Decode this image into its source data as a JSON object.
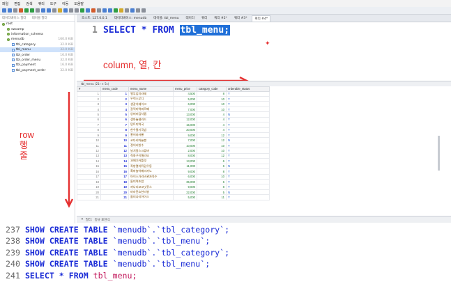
{
  "menubar": [
    "파일",
    "편집",
    "검색",
    "쿼리",
    "도구",
    "이동",
    "도움말"
  ],
  "tabs": [
    {
      "label": "호스트: 127.0.0.1",
      "active": false
    },
    {
      "label": "데이터베이스: menudb",
      "active": false
    },
    {
      "label": "테이블: tbl_menu",
      "active": false
    },
    {
      "label": "데이터",
      "active": false
    },
    {
      "label": "쿼리",
      "active": false
    },
    {
      "label": "쿼리 #2*",
      "active": false
    },
    {
      "label": "쿼리 #3*",
      "active": false
    },
    {
      "label": "쿼리 #4*",
      "active": true
    }
  ],
  "sidebar": {
    "filter_db": "데이터베이스 필터",
    "filter_table": "테이블 필터",
    "tree": [
      {
        "label": "root",
        "size": "",
        "indent": 0,
        "type": "db"
      },
      {
        "label": "swcamp",
        "size": "",
        "indent": 1,
        "type": "db"
      },
      {
        "label": "information_schema",
        "size": "",
        "indent": 1,
        "type": "db"
      },
      {
        "label": "menudb",
        "size": "160.0 KiB",
        "indent": 1,
        "type": "db"
      },
      {
        "label": "tbl_category",
        "size": "32.0 KiB",
        "indent": 2,
        "type": "table"
      },
      {
        "label": "tbl_menu",
        "size": "32.0 KiB",
        "indent": 2,
        "type": "table",
        "selected": true
      },
      {
        "label": "tbl_order",
        "size": "16.0 KiB",
        "indent": 2,
        "type": "table"
      },
      {
        "label": "tbl_order_menu",
        "size": "32.0 KiB",
        "indent": 2,
        "type": "table"
      },
      {
        "label": "tbl_payment",
        "size": "16.0 KiB",
        "indent": 2,
        "type": "table"
      },
      {
        "label": "tbl_payment_order",
        "size": "32.0 KiB",
        "indent": 2,
        "type": "table"
      }
    ]
  },
  "editor": {
    "line_number": "1",
    "sql_prefix": "SELECT * FROM ",
    "sql_highlight": "tbl_menu;"
  },
  "annotations": {
    "column_label": "column, 열, 칸",
    "row_label_lines": [
      "row",
      "행",
      "줄"
    ],
    "color": "#e53030"
  },
  "result": {
    "tab_label": "tbl_menu (21r × 5c)",
    "columns": [
      "#",
      "menu_code",
      "menu_name",
      "menu_price",
      "category_code",
      "orderable_status"
    ],
    "rows": [
      [
        "1",
        "1",
        "열무김치라떼",
        "4,500",
        "8",
        "Y"
      ],
      [
        "2",
        "2",
        "우럭스무디",
        "5,000",
        "10",
        "Y"
      ],
      [
        "3",
        "3",
        "생갈치쉐이크",
        "6,000",
        "10",
        "Y"
      ],
      [
        "4",
        "4",
        "갈릭미역파르페",
        "7,000",
        "10",
        "Y"
      ],
      [
        "5",
        "5",
        "앙버터김치찜",
        "13,000",
        "4",
        "N"
      ],
      [
        "6",
        "6",
        "생마늘샐러드",
        "12,000",
        "4",
        "Y"
      ],
      [
        "7",
        "7",
        "민트미역국",
        "15,000",
        "4",
        "Y"
      ],
      [
        "8",
        "8",
        "한우딸기국밥",
        "20,000",
        "4",
        "Y"
      ],
      [
        "9",
        "9",
        "홍어마카롱",
        "9,000",
        "12",
        "Y"
      ],
      [
        "10",
        "10",
        "코다리마늘빵",
        "7,000",
        "12",
        "N"
      ],
      [
        "11",
        "11",
        "정어리빙수",
        "10,000",
        "10",
        "Y"
      ],
      [
        "12",
        "12",
        "날치알스크류바",
        "2,000",
        "10",
        "Y"
      ],
      [
        "13",
        "13",
        "직화구이젤라또",
        "8,000",
        "12",
        "Y"
      ],
      [
        "14",
        "14",
        "과메기커틀릿",
        "13,000",
        "6",
        "Y"
      ],
      [
        "15",
        "15",
        "죽방멸치튀김우동",
        "11,000",
        "6",
        "N"
      ],
      [
        "16",
        "16",
        "흑마늘아메리카노",
        "9,000",
        "8",
        "Y"
      ],
      [
        "17",
        "17",
        "아이스가리비관자육수",
        "6,000",
        "10",
        "Y"
      ],
      [
        "18",
        "18",
        "돌미역초밥",
        "35,000",
        "6",
        "Y"
      ],
      [
        "19",
        "19",
        "까나리코코넛쥬스",
        "9,000",
        "8",
        "Y"
      ],
      [
        "20",
        "20",
        "마라깐쇼한라봉",
        "22,000",
        "5",
        "N"
      ],
      [
        "21",
        "21",
        "돌미나리아이스",
        "5,000",
        "11",
        "Y"
      ]
    ]
  },
  "status": {
    "label": "필터:",
    "hint": "정규 표현식"
  },
  "history": [
    {
      "num": "237",
      "kw": "SHOW CREATE TABLE",
      "ident": "`menudb`.`tbl_category`;",
      "plain": true
    },
    {
      "num": "238",
      "kw": "SHOW CREATE TABLE",
      "ident": "`menudb`.`tbl_menu`;",
      "plain": true
    },
    {
      "num": "239",
      "kw": "SHOW CREATE TABLE",
      "ident": "`menudb`.`tbl_category`;",
      "plain": true
    },
    {
      "num": "240",
      "kw": "SHOW CREATE TABLE",
      "ident": "`menudb`.`tbl_menu`;",
      "plain": true
    },
    {
      "num": "241",
      "kw": "SELECT * FROM",
      "ident": "tbl_menu;",
      "plain": false
    }
  ]
}
